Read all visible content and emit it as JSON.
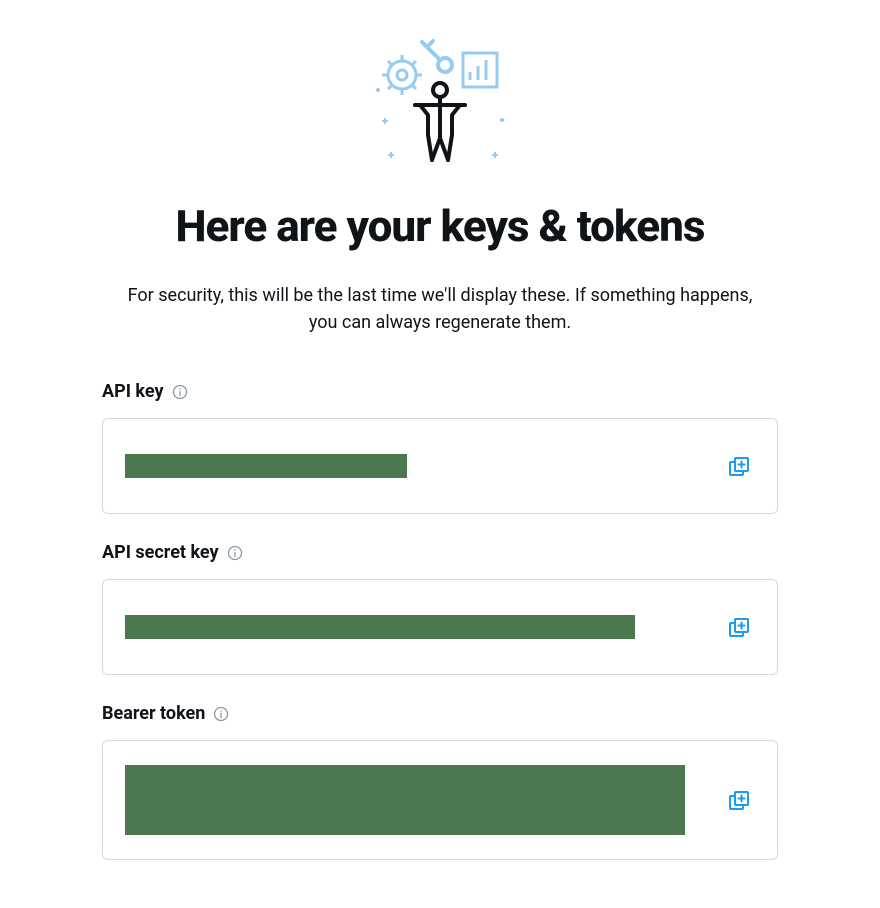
{
  "title": "Here are your keys & tokens",
  "subtitle": "For security, this will be the last time we'll display these. If something happens, you can always regenerate them.",
  "fields": {
    "api_key": {
      "label": "API key",
      "redacted_width": 282,
      "redacted_height": 24
    },
    "api_secret_key": {
      "label": "API secret key",
      "redacted_width": 510,
      "redacted_height": 24
    },
    "bearer_token": {
      "label": "Bearer token",
      "redacted_width": 560,
      "redacted_height": 70
    }
  },
  "colors": {
    "accent": "#1d9bf0",
    "redacted": "#4c7850",
    "border": "#cfd9de",
    "text": "#0f1419"
  }
}
